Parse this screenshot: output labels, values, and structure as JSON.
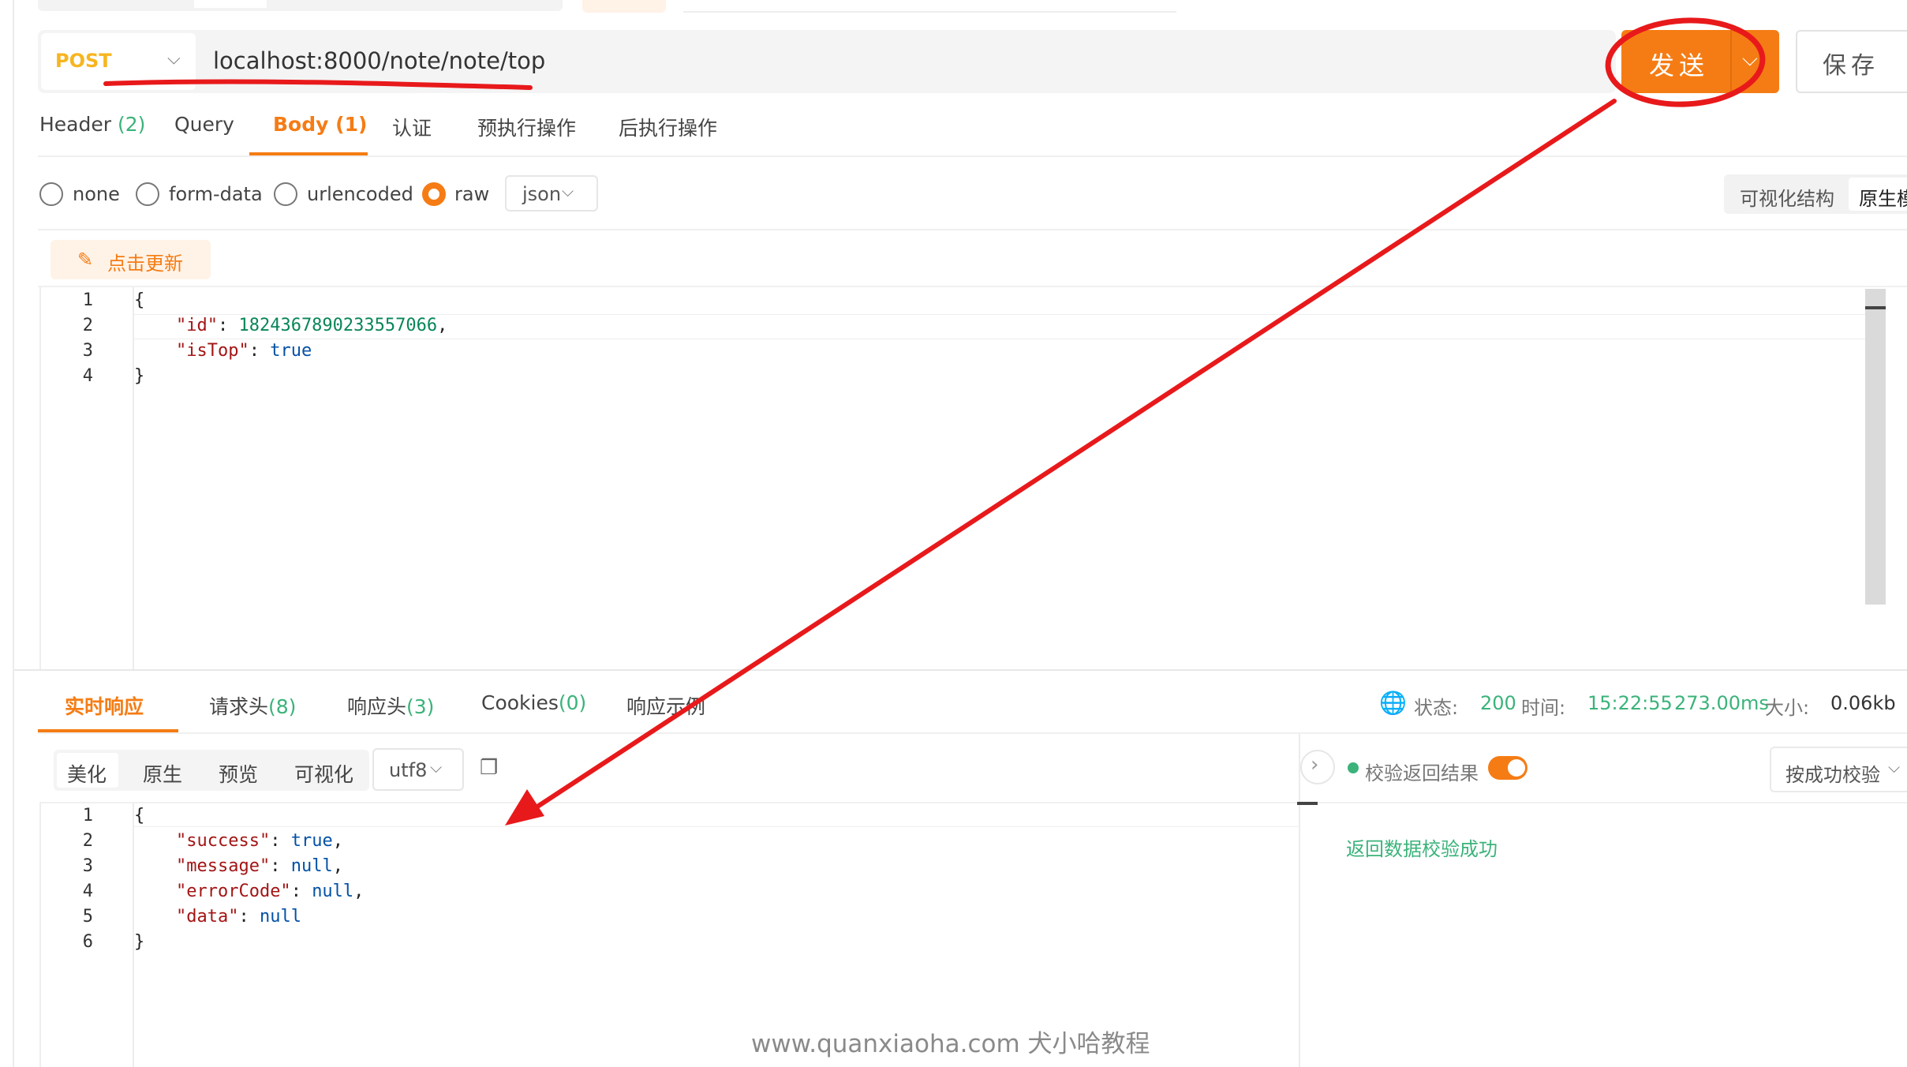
{
  "request": {
    "method": "POST",
    "url": "localhost:8000/note/note/top",
    "send_label": "发送",
    "save_label": "保存"
  },
  "request_tabs": [
    {
      "label": "Header ",
      "count": "(2)"
    },
    {
      "label": "Query",
      "count": ""
    },
    {
      "label": "Body ",
      "count": "(1)"
    },
    {
      "label": "认证",
      "count": ""
    },
    {
      "label": "预执行操作",
      "count": ""
    },
    {
      "label": "后执行操作",
      "count": ""
    }
  ],
  "body_types": [
    "none",
    "form-data",
    "urlencoded",
    "raw"
  ],
  "body_selected": "raw",
  "body_format": "json",
  "view_modes": {
    "visual": "可视化结构",
    "raw": "原生模"
  },
  "refresh_label": "点击更新",
  "request_body_lines": [
    {
      "n": "1",
      "parts": [
        {
          "t": "{",
          "c": ""
        }
      ]
    },
    {
      "n": "2",
      "parts": [
        {
          "t": "    ",
          "c": ""
        },
        {
          "t": "\"id\"",
          "c": "key"
        },
        {
          "t": ": ",
          "c": ""
        },
        {
          "t": "1824367890233557066",
          "c": "num"
        },
        {
          "t": ",",
          "c": ""
        }
      ]
    },
    {
      "n": "3",
      "parts": [
        {
          "t": "    ",
          "c": ""
        },
        {
          "t": "\"isTop\"",
          "c": "key"
        },
        {
          "t": ": ",
          "c": ""
        },
        {
          "t": "true",
          "c": "kw"
        }
      ]
    },
    {
      "n": "4",
      "parts": [
        {
          "t": "}",
          "c": ""
        }
      ]
    }
  ],
  "response_tabs": [
    {
      "label": "实时响应",
      "count": ""
    },
    {
      "label": "请求头",
      "count": "(8)"
    },
    {
      "label": "响应头",
      "count": "(3)"
    },
    {
      "label": "Cookies",
      "count": "(0)"
    },
    {
      "label": "响应示例",
      "count": ""
    }
  ],
  "response_stats": {
    "status_label": "状态:",
    "status_value": "200",
    "time_label": "时间:",
    "time_value": "15:22:55",
    "duration_value": "273.00ms",
    "size_label": "大小:",
    "size_value": "0.06kb"
  },
  "response_formats": [
    "美化",
    "原生",
    "预览",
    "可视化"
  ],
  "response_charset": "utf8",
  "validation": {
    "label": "校验返回结果",
    "enabled": true,
    "mode": "按成功校验",
    "result": "返回数据校验成功"
  },
  "response_body_lines": [
    {
      "n": "1",
      "parts": [
        {
          "t": "{",
          "c": ""
        }
      ]
    },
    {
      "n": "2",
      "parts": [
        {
          "t": "    ",
          "c": ""
        },
        {
          "t": "\"success\"",
          "c": "key"
        },
        {
          "t": ": ",
          "c": ""
        },
        {
          "t": "true",
          "c": "kw"
        },
        {
          "t": ",",
          "c": ""
        }
      ]
    },
    {
      "n": "3",
      "parts": [
        {
          "t": "    ",
          "c": ""
        },
        {
          "t": "\"message\"",
          "c": "key"
        },
        {
          "t": ": ",
          "c": ""
        },
        {
          "t": "null",
          "c": "kw"
        },
        {
          "t": ",",
          "c": ""
        }
      ]
    },
    {
      "n": "4",
      "parts": [
        {
          "t": "    ",
          "c": ""
        },
        {
          "t": "\"errorCode\"",
          "c": "key"
        },
        {
          "t": ": ",
          "c": ""
        },
        {
          "t": "null",
          "c": "kw"
        },
        {
          "t": ",",
          "c": ""
        }
      ]
    },
    {
      "n": "5",
      "parts": [
        {
          "t": "    ",
          "c": ""
        },
        {
          "t": "\"data\"",
          "c": "key"
        },
        {
          "t": ": ",
          "c": ""
        },
        {
          "t": "null",
          "c": "kw"
        }
      ]
    },
    {
      "n": "6",
      "parts": [
        {
          "t": "}",
          "c": ""
        }
      ]
    }
  ],
  "watermark": "www.quanxiaoha.com 犬小哈教程",
  "colors": {
    "accent": "#f57c14",
    "success": "#3bb37a",
    "method": "#f7b51f",
    "annotation": "#e8191b"
  }
}
